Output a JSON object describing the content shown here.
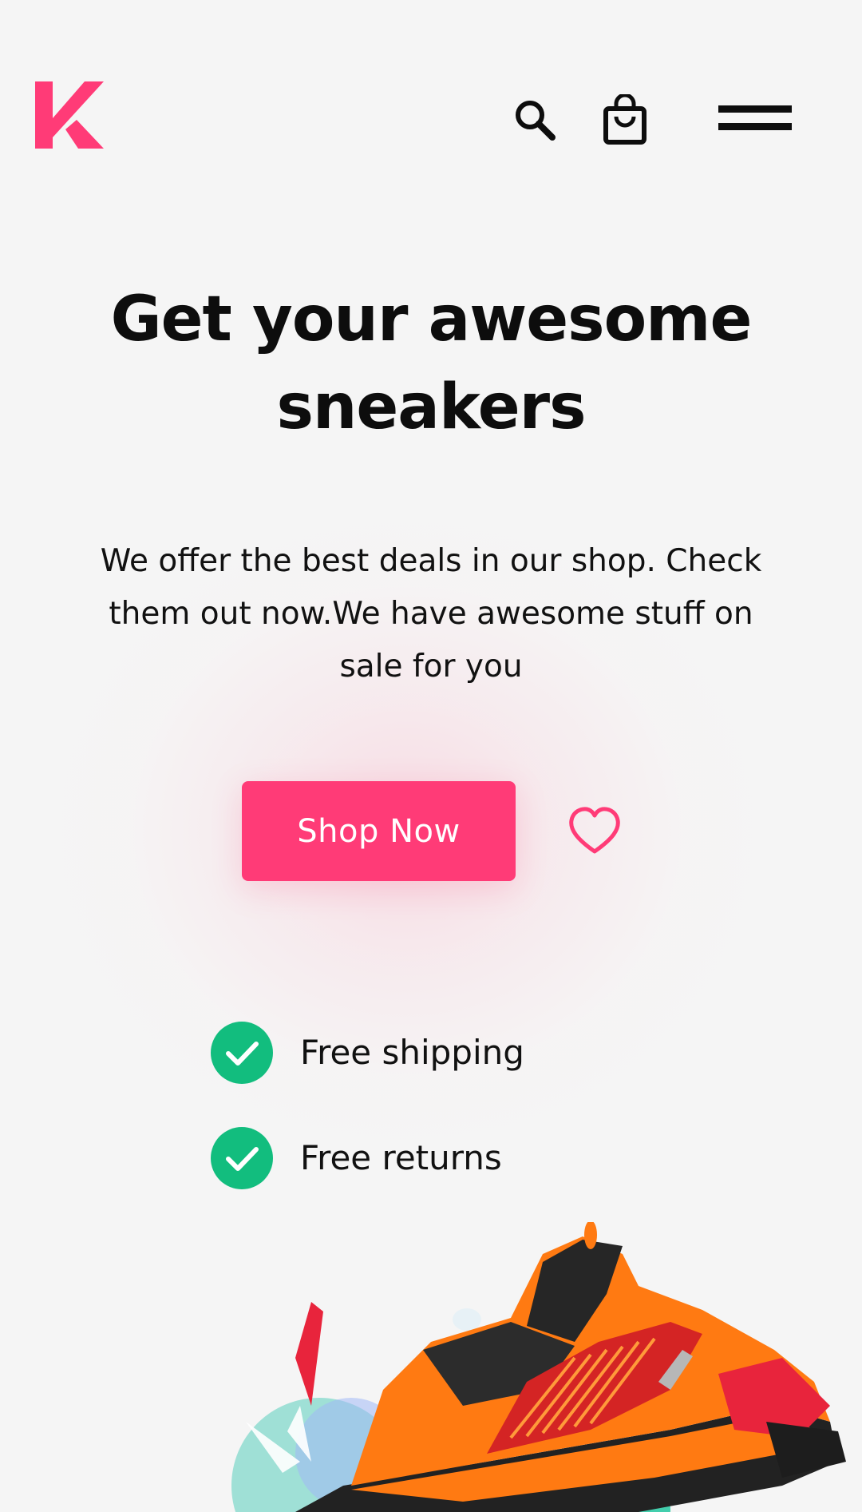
{
  "header": {
    "logo_icon": "k-logo-icon",
    "search_icon": "search-icon",
    "bag_icon": "shopping-bag-icon",
    "menu_icon": "hamburger-menu-icon"
  },
  "hero": {
    "title_line1": "Get your awesome",
    "title_line2": "sneakers",
    "description_line1": "We offer the best deals in our shop. Check",
    "description_line2": "them out now.We have awesome stuff on",
    "description_line3": "sale for you"
  },
  "cta": {
    "shop_label": "Shop Now",
    "heart_icon": "heart-outline-icon"
  },
  "features": [
    {
      "icon": "check-circle-icon",
      "label": "Free shipping"
    },
    {
      "icon": "check-circle-icon",
      "label": "Free returns"
    }
  ],
  "colors": {
    "brand_pink": "#ff3b77",
    "check_green": "#12bd7e",
    "background": "#f5f5f5",
    "text": "#111111"
  }
}
